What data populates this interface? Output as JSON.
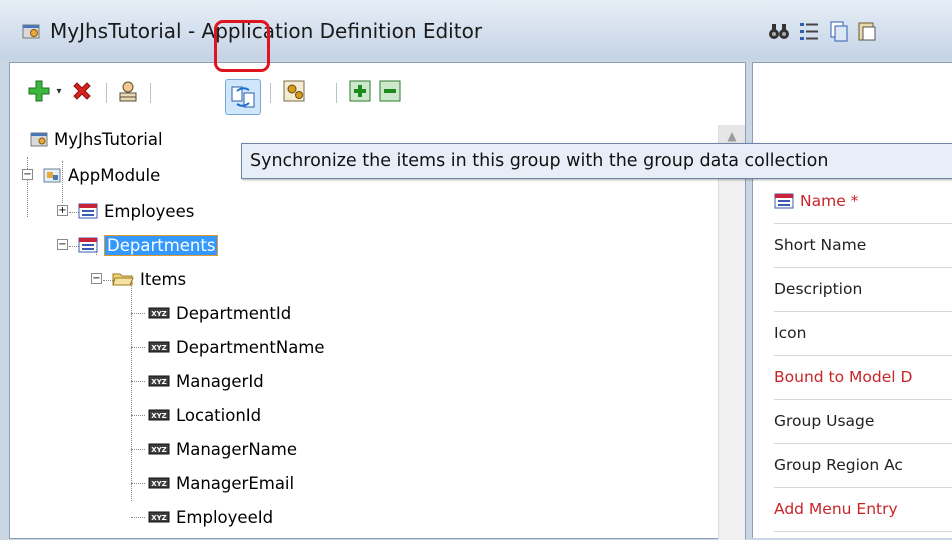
{
  "window": {
    "title": "MyJhsTutorial - Application Definition Editor",
    "icon": "app-definition-icon"
  },
  "toolbar": {
    "buttons": [
      {
        "name": "add-icon"
      },
      {
        "name": "dropdown-arrow-icon"
      },
      {
        "name": "delete-icon"
      },
      {
        "name": "users-icon"
      },
      {
        "name": "synchronize-icon"
      },
      {
        "name": "generate-icon"
      },
      {
        "name": "expand-all-icon"
      },
      {
        "name": "collapse-all-icon"
      }
    ],
    "highlight_color": "#e0141e"
  },
  "tooltip": {
    "text": "Synchronize the items in this group with the group data collection"
  },
  "tree": {
    "root": "MyJhsTutorial",
    "appmodule": "AppModule",
    "employees": "Employees",
    "departments": "Departments",
    "items_folder": "Items",
    "items": [
      "DepartmentId",
      "DepartmentName",
      "ManagerId",
      "LocationId",
      "ManagerName",
      "ManagerEmail",
      "EmployeeId"
    ]
  },
  "properties": {
    "name": "Name *",
    "rows": [
      {
        "label": "Short Name",
        "style": "dark"
      },
      {
        "label": "Description",
        "style": "dark"
      },
      {
        "label": "Icon",
        "style": "dark"
      },
      {
        "label": "Bound to Model D",
        "style": "red"
      },
      {
        "label": "Group Usage",
        "style": "dark"
      },
      {
        "label": "Group Region Ac",
        "style": "dark"
      },
      {
        "label": "Add Menu Entry",
        "style": "red"
      }
    ]
  }
}
